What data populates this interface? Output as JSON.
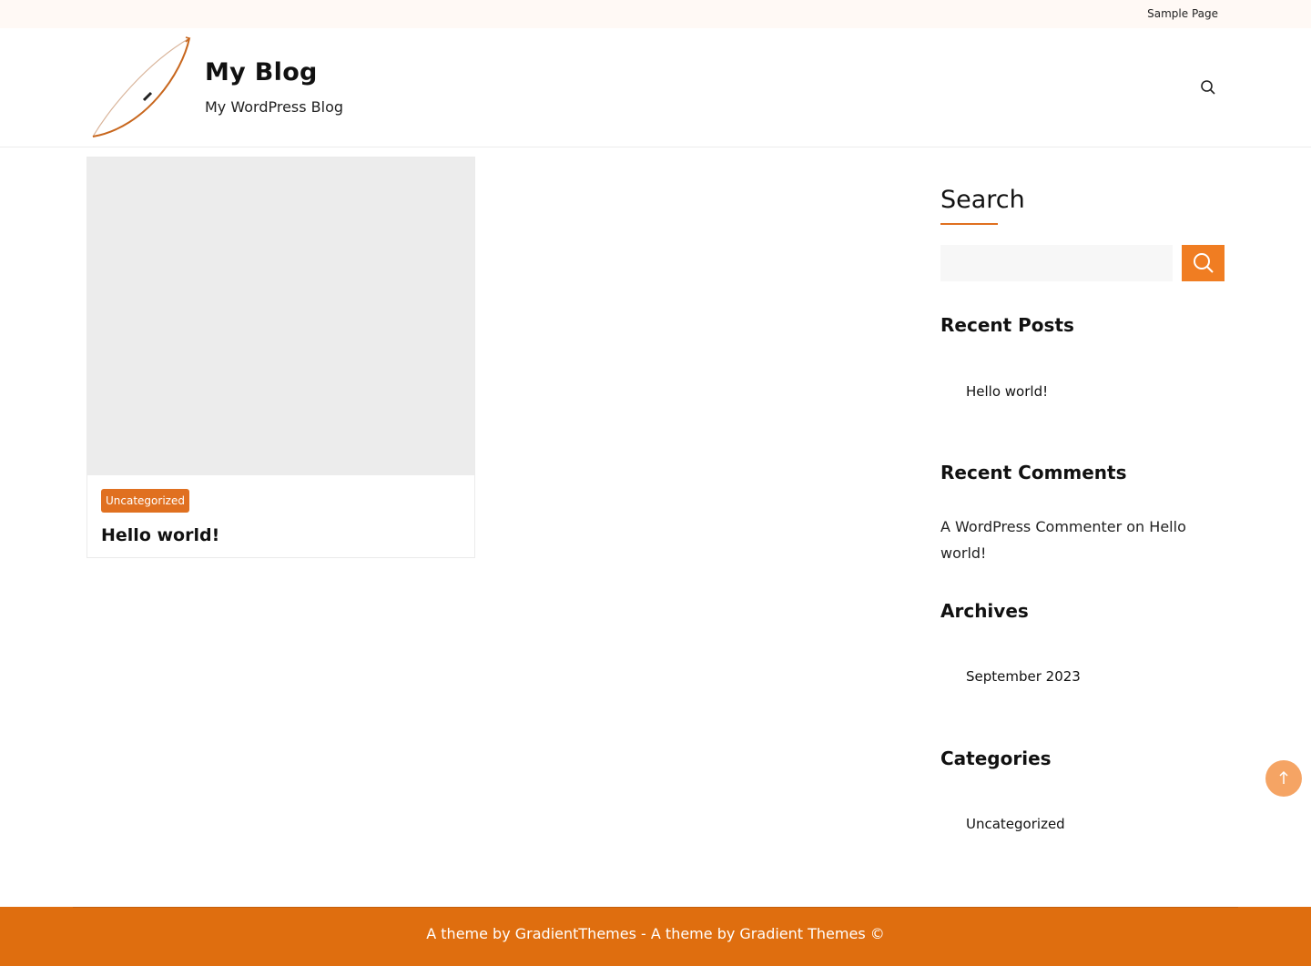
{
  "topbar": {
    "sample_page": "Sample Page"
  },
  "header": {
    "logo_icon": "bow-icon",
    "site_title": "My Blog",
    "site_description": "My WordPress Blog",
    "search_icon": "search-icon"
  },
  "post": {
    "category": "Uncategorized",
    "title": "Hello world!"
  },
  "sidebar": {
    "search_title": "Search",
    "search_button_icon": "search-icon",
    "recent_posts_title": "Recent Posts",
    "recent_posts": [
      "Hello world!"
    ],
    "recent_comments_title": "Recent Comments",
    "comment_author": "A WordPress Commenter",
    "comment_on": "on",
    "comment_post": "Hello world!",
    "archives_title": "Archives",
    "archives": [
      "September 2023"
    ],
    "categories_title": "Categories",
    "categories": [
      "Uncategorized"
    ]
  },
  "back_to_top_icon": "arrow-up-icon",
  "footer": {
    "prefix": "A theme by ",
    "link1": "GradientThemes",
    "middle": " - A theme by ",
    "link2": "Gradient Themes",
    "suffix": " ©"
  },
  "colors": {
    "accent": "#e07020",
    "footer_bg": "#df6e0f",
    "search_button": "#f07d22",
    "back_to_top": "#f5a464"
  }
}
